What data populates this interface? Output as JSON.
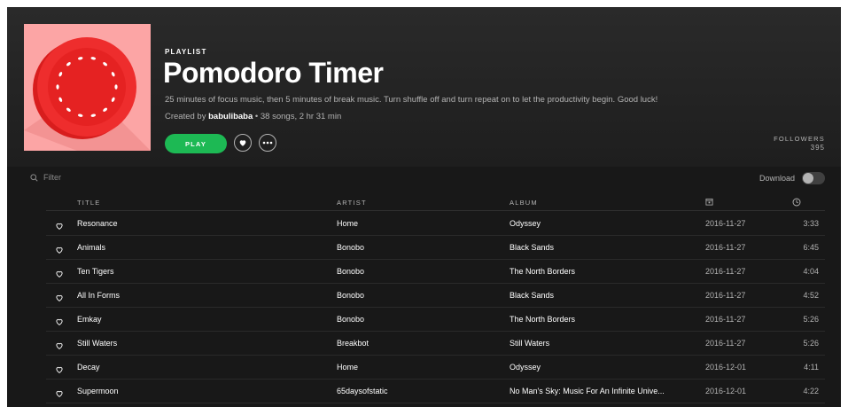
{
  "playlist": {
    "type_label": "PLAYLIST",
    "title": "Pomodoro Timer",
    "description": "25 minutes of focus music, then 5 minutes of break music. Turn shuffle off and turn repeat on to let the productivity begin. Good luck!",
    "created_by_prefix": "Created by ",
    "owner": "babulibaba",
    "meta": " • 38 songs, 2 hr 31 min",
    "play_label": "PLAY",
    "followers_label": "FOLLOWERS",
    "followers_count": "395"
  },
  "colors": {
    "accent": "#1db954",
    "cover_bg": "#fca5a5",
    "tomato": "#ee2d2d"
  },
  "filter": {
    "placeholder": "Filter",
    "icon": "search-icon"
  },
  "download": {
    "label": "Download",
    "enabled": false
  },
  "table": {
    "headers": {
      "title": "TITLE",
      "artist": "ARTIST",
      "album": "ALBUM",
      "added_icon": "calendar-icon",
      "duration_icon": "clock-icon"
    },
    "rows": [
      {
        "title": "Resonance",
        "artist": "Home",
        "album": "Odyssey",
        "added": "2016-11-27",
        "duration": "3:33"
      },
      {
        "title": "Animals",
        "artist": "Bonobo",
        "album": "Black Sands",
        "added": "2016-11-27",
        "duration": "6:45"
      },
      {
        "title": "Ten Tigers",
        "artist": "Bonobo",
        "album": "The North Borders",
        "added": "2016-11-27",
        "duration": "4:04"
      },
      {
        "title": "All In Forms",
        "artist": "Bonobo",
        "album": "Black Sands",
        "added": "2016-11-27",
        "duration": "4:52"
      },
      {
        "title": "Emkay",
        "artist": "Bonobo",
        "album": "The North Borders",
        "added": "2016-11-27",
        "duration": "5:26"
      },
      {
        "title": "Still Waters",
        "artist": "Breakbot",
        "album": "Still Waters",
        "added": "2016-11-27",
        "duration": "5:26"
      },
      {
        "title": "Decay",
        "artist": "Home",
        "album": "Odyssey",
        "added": "2016-12-01",
        "duration": "4:11"
      },
      {
        "title": "Supermoon",
        "artist": "65daysofstatic",
        "album": "No Man's Sky: Music For An Infinite Unive...",
        "added": "2016-12-01",
        "duration": "4:22"
      }
    ]
  }
}
